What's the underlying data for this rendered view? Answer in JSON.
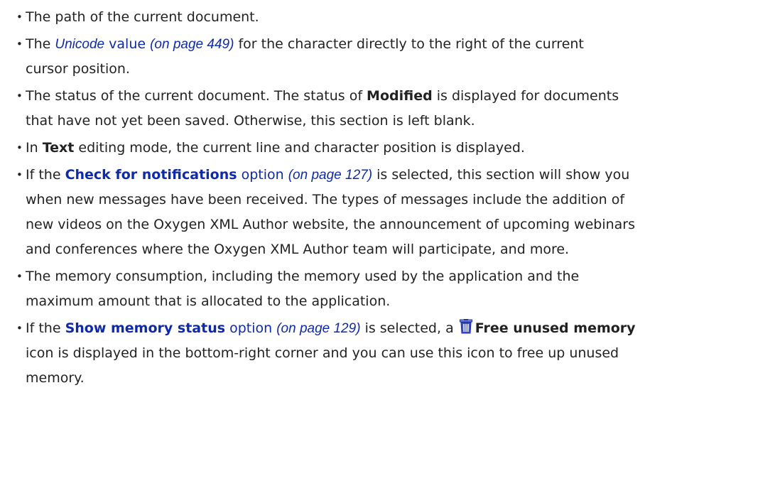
{
  "items": {
    "path": {
      "text": "The path of the current document."
    },
    "unicode": {
      "before": "The ",
      "link_italic": "Unicode",
      "link_rest": " value",
      "pageref": "(on page 449)",
      "after_line1": " for the character directly to the right of the current",
      "after_line2": "cursor position."
    },
    "status": {
      "before": "The status of the current document. The status of ",
      "bold": "Modified",
      "after_line1": " is displayed for documents",
      "after_line2": "that have not yet been saved. Otherwise, this section is left blank."
    },
    "text_mode": {
      "before": "In ",
      "bold": "Text",
      "after": " editing mode, the current line and character position is displayed."
    },
    "notifications": {
      "before": "If the ",
      "link_bold": "Check for notifications",
      "link_rest": " option",
      "pageref": "(on page 127)",
      "after_line1": " is selected, this section will show you",
      "line2": "when new messages have been received. The types of messages include the addition of",
      "line3": "new videos on the Oxygen XML Author website, the announcement of upcoming webinars",
      "line4": "and conferences where the Oxygen XML Author team will participate, and more."
    },
    "memory": {
      "line1": "The memory consumption, including the memory used by the application and the",
      "line2": "maximum amount that is allocated to the application."
    },
    "memory_status": {
      "before": "If the ",
      "link_bold": "Show memory status",
      "link_rest": " option",
      "pageref": "(on page 129)",
      "middle": " is selected, a ",
      "icon": "trash-icon",
      "bold": "Free unused memory",
      "line2": "icon is displayed in the bottom-right corner and you can use this icon to free up unused",
      "line3": "memory."
    }
  },
  "colors": {
    "link": "#0f2aa8",
    "text": "#222222",
    "icon_body": "#3b4fc8"
  }
}
